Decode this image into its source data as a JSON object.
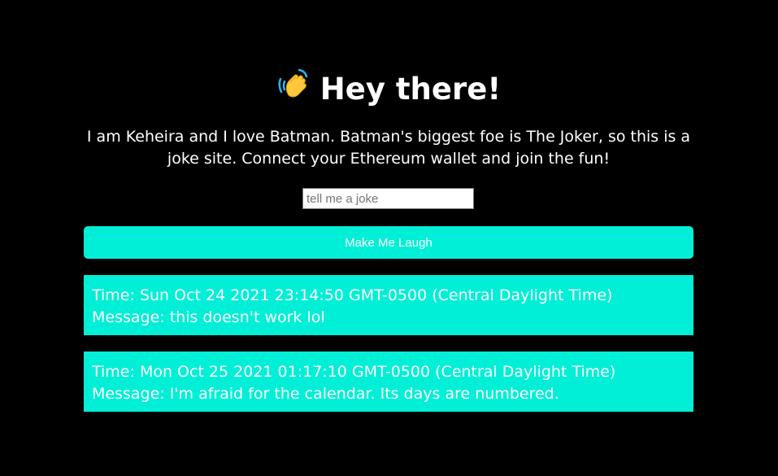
{
  "header": {
    "emoji": "👋",
    "title": "Hey there!"
  },
  "bio": {
    "text": "I am Keheira and I love Batman. Batman's biggest foe is The Joker, so this is a joke site. Connect your Ethereum wallet and join the fun!"
  },
  "form": {
    "input_value": "",
    "input_placeholder": "tell me a joke",
    "button_label": "Make Me Laugh"
  },
  "waves": [
    {
      "time_label": "Time: Sun Oct 24 2021 23:14:50 GMT-0500 (Central Daylight Time)",
      "message_label": "Message: this doesn't work lol"
    },
    {
      "time_label": "Time: Mon Oct 25 2021 01:17:10 GMT-0500 (Central Daylight Time)",
      "message_label": "Message: I'm afraid for the calendar. Its days are numbered."
    }
  ],
  "colors": {
    "background": "#000000",
    "accent": "#00efd6",
    "text": "#ffffff"
  }
}
